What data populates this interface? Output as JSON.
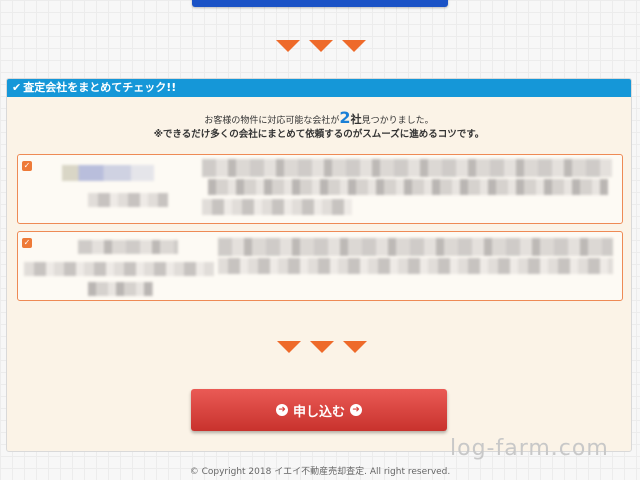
{
  "panel": {
    "header_check": "✔",
    "title": "査定会社をまとめてチェック!!"
  },
  "summary": {
    "line_prefix": "お客様の物件に対応可能な会社が",
    "count": "2",
    "count_unit": "社",
    "line_suffix": "見つかりました。",
    "tip": "※できるだけ多くの会社にまとめて依頼するのがスムーズに進めるコツです。"
  },
  "companies": [
    {
      "checked": true
    },
    {
      "checked": true
    }
  ],
  "apply_button": {
    "label": "申し込む"
  },
  "watermark": "log-farm.com",
  "copyright": "© Copyright 2018 イエイ不動産売却査定. All right reserved.",
  "colors": {
    "accent_blue": "#1597d8",
    "arrow_orange": "#ee6a2a",
    "button_red": "#d9423d"
  }
}
